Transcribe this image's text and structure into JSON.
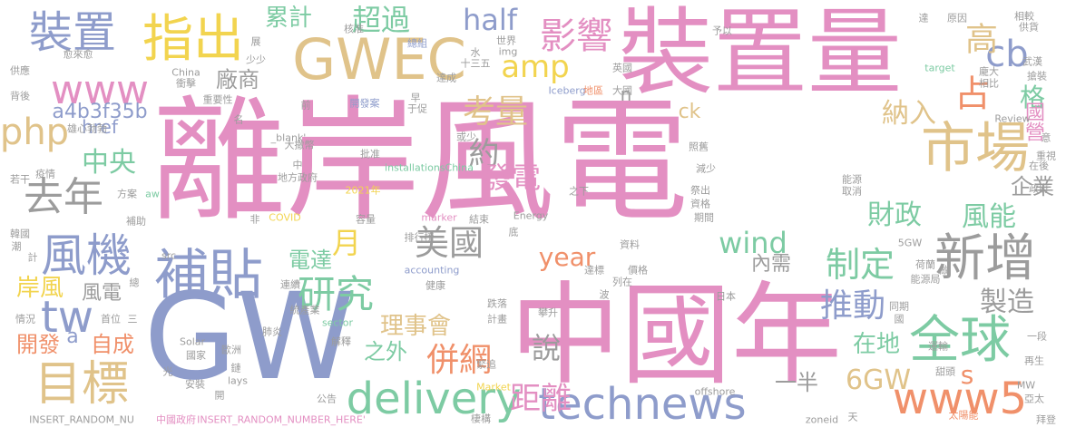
{
  "palette": {
    "pink": "#e38fc2",
    "blue": "#8e9ccb",
    "gray": "#9c9c9c",
    "tan": "#e0c38a",
    "green": "#7dcba3",
    "orange": "#f0906a",
    "yellow": "#f2d44f"
  },
  "words": [
    {
      "text": "離岸風電",
      "color": "pink"
    },
    {
      "text": "中國年",
      "color": "pink"
    },
    {
      "text": "裝置量",
      "color": "pink"
    },
    {
      "text": "GW",
      "color": "blue"
    },
    {
      "text": "GWEC",
      "color": "tan"
    },
    {
      "text": "指出",
      "color": "yellow"
    },
    {
      "text": "裝置",
      "color": "blue"
    },
    {
      "text": "市場",
      "color": "tan"
    },
    {
      "text": "新增",
      "color": "gray"
    },
    {
      "text": "全球",
      "color": "green"
    },
    {
      "text": "補貼",
      "color": "blue"
    },
    {
      "text": "目標",
      "color": "tan"
    },
    {
      "text": "technews",
      "color": "blue"
    },
    {
      "text": "www5",
      "color": "orange"
    },
    {
      "text": "delivery",
      "color": "green"
    },
    {
      "text": "www",
      "color": "pink"
    },
    {
      "text": "風機",
      "color": "blue"
    },
    {
      "text": "研究",
      "color": "green"
    },
    {
      "text": "影響",
      "color": "pink"
    },
    {
      "text": "超過",
      "color": "green"
    },
    {
      "text": "累計",
      "color": "green"
    },
    {
      "text": "half",
      "color": "blue"
    },
    {
      "text": "amp",
      "color": "yellow"
    },
    {
      "text": "cb",
      "color": "blue"
    },
    {
      "text": "高",
      "color": "tan"
    },
    {
      "text": "占",
      "color": "orange"
    },
    {
      "text": "格",
      "color": "green"
    },
    {
      "text": "考量",
      "color": "tan"
    },
    {
      "text": "約",
      "color": "gray"
    },
    {
      "text": "發電",
      "color": "pink"
    },
    {
      "text": "納入",
      "color": "tan"
    },
    {
      "text": "國營",
      "color": "pink"
    },
    {
      "text": "php",
      "color": "tan"
    },
    {
      "text": "去年",
      "color": "gray"
    },
    {
      "text": "中央",
      "color": "green"
    },
    {
      "text": "tw",
      "color": "blue"
    },
    {
      "text": "a4b3f35b",
      "color": "blue"
    },
    {
      "text": "廠商",
      "color": "gray"
    },
    {
      "text": "href",
      "color": "blue"
    },
    {
      "text": "ck",
      "color": "tan"
    },
    {
      "text": "財政",
      "color": "green"
    },
    {
      "text": "風能",
      "color": "green"
    },
    {
      "text": "企業",
      "color": "gray"
    },
    {
      "text": "美國",
      "color": "gray"
    },
    {
      "text": "月",
      "color": "yellow"
    },
    {
      "text": "wind",
      "color": "green"
    },
    {
      "text": "year",
      "color": "orange"
    },
    {
      "text": "電達",
      "color": "green"
    },
    {
      "text": "制定",
      "color": "green"
    },
    {
      "text": "內需",
      "color": "gray"
    },
    {
      "text": "推動",
      "color": "blue"
    },
    {
      "text": "製造",
      "color": "gray"
    },
    {
      "text": "岸風",
      "color": "yellow"
    },
    {
      "text": "風電",
      "color": "gray"
    },
    {
      "text": "理事會",
      "color": "tan"
    },
    {
      "text": "併網",
      "color": "orange"
    },
    {
      "text": "說",
      "color": "gray"
    },
    {
      "text": "之外",
      "color": "green"
    },
    {
      "text": "在地",
      "color": "green"
    },
    {
      "text": "一半",
      "color": "gray"
    },
    {
      "text": "6GW",
      "color": "tan"
    },
    {
      "text": "s",
      "color": "orange"
    },
    {
      "text": "距離",
      "color": "pink"
    },
    {
      "text": "開發",
      "color": "orange"
    },
    {
      "text": "自成",
      "color": "orange"
    },
    {
      "text": "a",
      "color": "blue"
    },
    {
      "text": "n",
      "color": "gray"
    },
    {
      "text": "核准",
      "color": "gray"
    },
    {
      "text": "重要性",
      "color": "gray"
    },
    {
      "text": "開發案",
      "color": "blue"
    },
    {
      "text": "Iceberg",
      "color": "blue"
    },
    {
      "text": "installationsChina",
      "color": "green"
    },
    {
      "text": "COVID",
      "color": "yellow"
    },
    {
      "text": "marker",
      "color": "pink"
    },
    {
      "text": "Energy",
      "color": "gray"
    },
    {
      "text": "accounting",
      "color": "blue"
    },
    {
      "text": "sector",
      "color": "green"
    },
    {
      "text": "Solar",
      "color": "gray"
    },
    {
      "text": "Market",
      "color": "yellow"
    },
    {
      "text": "offshore",
      "color": "gray"
    },
    {
      "text": "zoneid",
      "color": "gray"
    },
    {
      "text": "INSERT_RANDOM_NU",
      "color": "gray"
    },
    {
      "text": "INSERT_RANDOM_NUMBER_HERE'",
      "color": "pink"
    },
    {
      "text": "中國政府",
      "color": "pink"
    },
    {
      "text": "target",
      "color": "green"
    },
    {
      "text": "Review",
      "color": "gray"
    },
    {
      "text": "5GW",
      "color": "gray"
    },
    {
      "text": "MW",
      "color": "gray"
    },
    {
      "text": "2021年",
      "color": "yellow"
    },
    {
      "text": "_blank'",
      "color": "gray"
    },
    {
      "text": "img",
      "color": "gray"
    },
    {
      "text": "China",
      "color": "gray"
    },
    {
      "text": "src",
      "color": "gray"
    },
    {
      "text": "aw",
      "color": "green"
    },
    {
      "text": "lays",
      "color": "gray"
    },
    {
      "text": "世界",
      "color": "gray"
    },
    {
      "text": "十三五",
      "color": "gray"
    },
    {
      "text": "英國",
      "color": "gray"
    },
    {
      "text": "大國",
      "color": "gray"
    },
    {
      "text": "地區",
      "color": "orange"
    },
    {
      "text": "達成",
      "color": "gray"
    },
    {
      "text": "總組",
      "color": "blue"
    },
    {
      "text": "水",
      "color": "gray"
    },
    {
      "text": "早",
      "color": "gray"
    },
    {
      "text": "于促",
      "color": "gray"
    },
    {
      "text": "或少",
      "color": "gray"
    },
    {
      "text": "照舊",
      "color": "gray"
    },
    {
      "text": "減少",
      "color": "gray"
    },
    {
      "text": "祭出",
      "color": "gray"
    },
    {
      "text": "資格",
      "color": "gray"
    },
    {
      "text": "期間",
      "color": "gray"
    },
    {
      "text": "能源",
      "color": "gray"
    },
    {
      "text": "取消",
      "color": "gray"
    },
    {
      "text": "之下",
      "color": "gray"
    },
    {
      "text": "容量",
      "color": "gray"
    },
    {
      "text": "結束",
      "color": "gray"
    },
    {
      "text": "排行榜",
      "color": "gray"
    },
    {
      "text": "資料",
      "color": "gray"
    },
    {
      "text": "價格",
      "color": "gray"
    },
    {
      "text": "跌落",
      "color": "gray"
    },
    {
      "text": "計畫",
      "color": "gray"
    },
    {
      "text": "攀升",
      "color": "gray"
    },
    {
      "text": "波",
      "color": "gray"
    },
    {
      "text": "列在",
      "color": "gray"
    },
    {
      "text": "達標",
      "color": "gray"
    },
    {
      "text": "健康",
      "color": "gray"
    },
    {
      "text": "連續",
      "color": "gray"
    },
    {
      "text": "統產業",
      "color": "gray"
    },
    {
      "text": "肺炎",
      "color": "gray"
    },
    {
      "text": "解釋",
      "color": "gray"
    },
    {
      "text": "國家",
      "color": "gray"
    },
    {
      "text": "歐洲",
      "color": "gray"
    },
    {
      "text": "鏈",
      "color": "gray"
    },
    {
      "text": "安裝",
      "color": "gray"
    },
    {
      "text": "光",
      "color": "gray"
    },
    {
      "text": "公告",
      "color": "gray"
    },
    {
      "text": "緊追",
      "color": "gray"
    },
    {
      "text": "棲構",
      "color": "gray"
    },
    {
      "text": "太陽能",
      "color": "orange"
    },
    {
      "text": "甜頭",
      "color": "gray"
    },
    {
      "text": "再生",
      "color": "gray"
    },
    {
      "text": "亞太",
      "color": "gray"
    },
    {
      "text": "拜登",
      "color": "gray"
    },
    {
      "text": "天",
      "color": "gray"
    },
    {
      "text": "運輸",
      "color": "gray"
    },
    {
      "text": "一段",
      "color": "gray"
    },
    {
      "text": "日本",
      "color": "gray"
    },
    {
      "text": "同期",
      "color": "gray"
    },
    {
      "text": "國",
      "color": "gray"
    },
    {
      "text": "荷蘭",
      "color": "gray"
    },
    {
      "text": "能源局",
      "color": "gray"
    },
    {
      "text": "做",
      "color": "gray"
    },
    {
      "text": "在後",
      "color": "gray"
    },
    {
      "text": "政府",
      "color": "gray"
    },
    {
      "text": "重視",
      "color": "gray"
    },
    {
      "text": "意",
      "color": "gray"
    },
    {
      "text": "相比",
      "color": "gray"
    },
    {
      "text": "龐大",
      "color": "gray"
    },
    {
      "text": "武漢",
      "color": "gray"
    },
    {
      "text": "搶裝",
      "color": "gray"
    },
    {
      "text": "原因",
      "color": "gray"
    },
    {
      "text": "供貨",
      "color": "gray"
    },
    {
      "text": "相較",
      "color": "gray"
    },
    {
      "text": "達",
      "color": "gray"
    },
    {
      "text": "予以",
      "color": "gray"
    },
    {
      "text": "展",
      "color": "gray"
    },
    {
      "text": "少少",
      "color": "gray"
    },
    {
      "text": "衝擊",
      "color": "gray"
    },
    {
      "text": "供應",
      "color": "gray"
    },
    {
      "text": "背後",
      "color": "gray"
    },
    {
      "text": "愈來愈",
      "color": "gray"
    },
    {
      "text": "雄心勃勃",
      "color": "gray"
    },
    {
      "text": "名",
      "color": "gray"
    },
    {
      "text": "前",
      "color": "gray"
    },
    {
      "text": "大撒幣",
      "color": "gray"
    },
    {
      "text": "批准",
      "color": "gray"
    },
    {
      "text": "地方政府",
      "color": "gray"
    },
    {
      "text": "疫情",
      "color": "gray"
    },
    {
      "text": "若干",
      "color": "gray"
    },
    {
      "text": "方案",
      "color": "gray"
    },
    {
      "text": "補助",
      "color": "gray"
    },
    {
      "text": "韓國",
      "color": "gray"
    },
    {
      "text": "潮",
      "color": "gray"
    },
    {
      "text": "計",
      "color": "gray"
    },
    {
      "text": "總",
      "color": "gray"
    },
    {
      "text": "情況",
      "color": "gray"
    },
    {
      "text": "首位",
      "color": "gray"
    },
    {
      "text": "三",
      "color": "gray"
    },
    {
      "text": "開",
      "color": "gray"
    },
    {
      "text": "非",
      "color": "gray"
    },
    {
      "text": "中",
      "color": "gray"
    },
    {
      "text": "底",
      "color": "gray"
    }
  ]
}
